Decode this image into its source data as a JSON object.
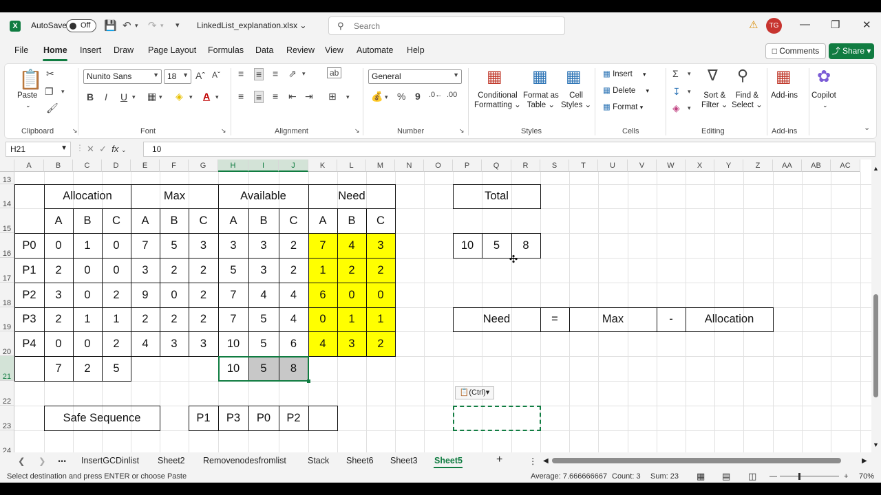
{
  "app": {
    "autosave_label": "AutoSave",
    "autosave_state": "Off",
    "filename": "LinkedList_explanation.xlsx",
    "search_placeholder": "Search",
    "user_initials": "TG"
  },
  "menu": {
    "tabs": [
      "File",
      "Home",
      "Insert",
      "Draw",
      "Page Layout",
      "Formulas",
      "Data",
      "Review",
      "View",
      "Automate",
      "Help"
    ],
    "active": "Home",
    "comments_label": "Comments",
    "share_label": "Share"
  },
  "ribbon": {
    "paste": "Paste",
    "font_name": "Nunito Sans",
    "font_size": "18",
    "number_format": "General",
    "conditional_formatting": [
      "Conditional",
      "Formatting"
    ],
    "format_as_table": [
      "Format as",
      "Table"
    ],
    "cell_styles": [
      "Cell",
      "Styles"
    ],
    "insert": "Insert",
    "delete": "Delete",
    "format": "Format",
    "sort_filter": [
      "Sort &",
      "Filter"
    ],
    "find_select": [
      "Find &",
      "Select"
    ],
    "addins": "Add-ins",
    "copilot": "Copilot",
    "groups": [
      "Clipboard",
      "Font",
      "Alignment",
      "Number",
      "Styles",
      "Cells",
      "Editing",
      "Add-ins"
    ]
  },
  "formula_bar": {
    "name_box": "H21",
    "formula": "10"
  },
  "columns": [
    "A",
    "B",
    "C",
    "D",
    "E",
    "F",
    "G",
    "H",
    "I",
    "J",
    "K",
    "L",
    "M",
    "N",
    "O",
    "P",
    "Q",
    "R",
    "S",
    "T",
    "U",
    "V",
    "W",
    "X",
    "Y",
    "Z",
    "AA",
    "AB",
    "AC"
  ],
  "rows": [
    "13",
    "14",
    "15",
    "16",
    "17",
    "18",
    "19",
    "20",
    "21",
    "22",
    "23",
    "24"
  ],
  "table": {
    "group_headers": [
      "Allocation",
      "Max",
      "Available",
      "Need"
    ],
    "sub_headers": [
      "A",
      "B",
      "C",
      "A",
      "B",
      "C",
      "A",
      "B",
      "C",
      "A",
      "B",
      "C"
    ],
    "processes": [
      "P0",
      "P1",
      "P2",
      "P3",
      "P4"
    ],
    "allocation": [
      [
        "0",
        "1",
        "0"
      ],
      [
        "2",
        "0",
        "0"
      ],
      [
        "3",
        "0",
        "2"
      ],
      [
        "2",
        "1",
        "1"
      ],
      [
        "0",
        "0",
        "2"
      ]
    ],
    "max": [
      [
        "7",
        "5",
        "3"
      ],
      [
        "3",
        "2",
        "2"
      ],
      [
        "9",
        "0",
        "2"
      ],
      [
        "2",
        "2",
        "2"
      ],
      [
        "4",
        "3",
        "3"
      ]
    ],
    "available": [
      [
        "3",
        "3",
        "2"
      ],
      [
        "5",
        "3",
        "2"
      ],
      [
        "7",
        "4",
        "4"
      ],
      [
        "7",
        "5",
        "4"
      ],
      [
        "10",
        "5",
        "6"
      ]
    ],
    "need": [
      [
        "7",
        "4",
        "3"
      ],
      [
        "1",
        "2",
        "2"
      ],
      [
        "6",
        "0",
        "0"
      ],
      [
        "0",
        "1",
        "1"
      ],
      [
        "4",
        "3",
        "2"
      ]
    ],
    "alloc_totals": [
      "7",
      "2",
      "5"
    ],
    "available_final": [
      "10",
      "5",
      "8"
    ]
  },
  "total_box": {
    "label": "Total",
    "values": [
      "10",
      "5",
      "8"
    ]
  },
  "equation": [
    "Need",
    "=",
    "Max",
    "-",
    "Allocation"
  ],
  "safe_sequence": {
    "label": "Safe Sequence",
    "values": [
      "P1",
      "P3",
      "P0",
      "P2",
      ""
    ]
  },
  "paste_options": "(Ctrl)",
  "sheets": [
    "InsertGCDinlist",
    "Sheet2",
    "Removenodesfromlist",
    "Stack",
    "Sheet6",
    "Sheet3",
    "Sheet5"
  ],
  "active_sheet": "Sheet5",
  "status": {
    "message": "Select destination and press ENTER or choose Paste",
    "average": "Average: 7.666666667",
    "count": "Count: 3",
    "sum": "Sum: 23",
    "zoom": "70%"
  }
}
